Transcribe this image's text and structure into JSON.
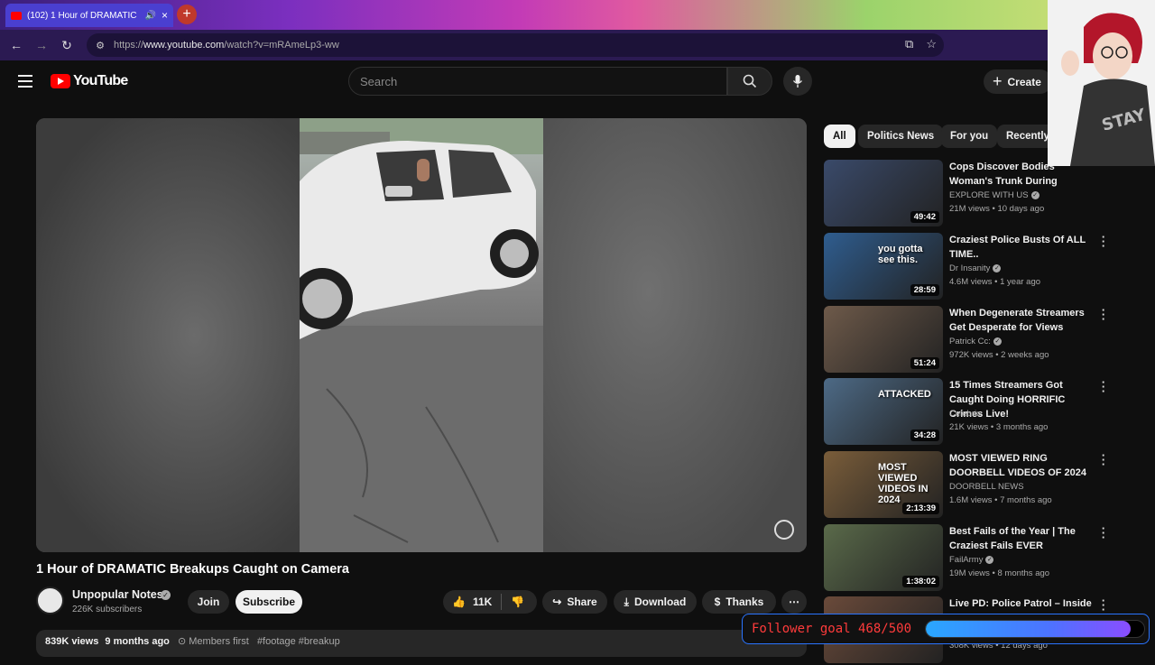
{
  "browser": {
    "tab_title": "(102) 1 Hour of DRAMATIC",
    "tab_close": "×",
    "new_tab": "+",
    "url_prefix": "https://",
    "url_host": "www.youtube.com",
    "url_path": "/watch?v=mRAmeLp3-ww"
  },
  "header": {
    "logo_text": "YouTube",
    "search_placeholder": "Search",
    "create_label": "Create"
  },
  "player": {
    "accent": "#ff0000"
  },
  "video": {
    "title": "1 Hour of DRAMATIC Breakups Caught on Camera",
    "channel_name": "Unpopular Notes",
    "subscribers": "226K subscribers",
    "join_label": "Join",
    "subscribe_label": "Subscribe",
    "likes": "11K",
    "share_label": "Share",
    "download_label": "Download",
    "thanks_label": "Thanks",
    "views": "839K views",
    "age": "9 months ago",
    "members": "Members first",
    "tags": "#footage #breakup"
  },
  "chips": [
    "All",
    "Politics News",
    "For you",
    "Recently"
  ],
  "recommendations": [
    {
      "title": "Cops Discover Bodies Woman's Trunk During",
      "channel": "EXPLORE WITH US",
      "verified": true,
      "meta": "21M views • 10 days ago",
      "duration": "49:42",
      "thumb_color": "#3a4a6a"
    },
    {
      "title": "Craziest Police Busts Of ALL TIME..",
      "channel": "Dr Insanity",
      "verified": true,
      "meta": "4.6M views • 1 year ago",
      "duration": "28:59",
      "thumb_color": "#2f5d8f",
      "overlay": "you gotta see this."
    },
    {
      "title": "When Degenerate Streamers Get Desperate for Views",
      "channel": "Patrick Cc:",
      "verified": true,
      "meta": "972K views • 2 weeks ago",
      "duration": "51:24",
      "thumb_color": "#6e5a4a"
    },
    {
      "title": "15 Times Streamers Got Caught Doing HORRIFIC Crimes Live!",
      "channel": "Celebrix",
      "verified": false,
      "meta": "21K views • 3 months ago",
      "duration": "34:28",
      "thumb_color": "#4d6a86",
      "overlay": "ATTACKED"
    },
    {
      "title": "MOST VIEWED RING DOORBELL VIDEOS OF 2024",
      "channel": "DOORBELL NEWS",
      "verified": false,
      "meta": "1.6M views • 7 months ago",
      "duration": "2:13:39",
      "thumb_color": "#7a5d3a",
      "overlay": "MOST VIEWED VIDEOS IN 2024"
    },
    {
      "title": "Best Fails of the Year | The Craziest Fails EVER",
      "channel": "FailArmy",
      "verified": true,
      "meta": "19M views • 8 months ago",
      "duration": "1:38:02",
      "thumb_color": "#5a6a4a"
    },
    {
      "title": "Live PD: Police Patrol – Inside",
      "channel": "",
      "verified": false,
      "meta": "308K views • 12 days ago",
      "duration": "",
      "thumb_color": "#6a4a3a"
    }
  ],
  "overlay": {
    "follower_label": "Follower goal 468/500",
    "follower_progress": 0.936
  }
}
